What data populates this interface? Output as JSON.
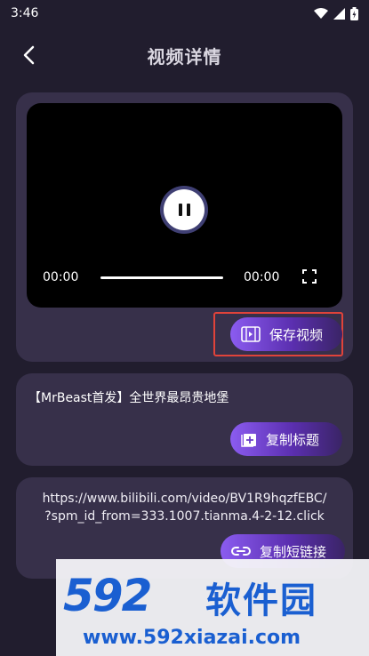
{
  "status_bar": {
    "time": "3:46"
  },
  "header": {
    "title": "视频详情"
  },
  "player": {
    "current_time": "00:00",
    "duration": "00:00",
    "progress": 0
  },
  "video_card": {
    "save_label": "保存视频"
  },
  "title_card": {
    "title": "【MrBeast首发】全世界最昂贵地堡",
    "copy_label": "复制标题"
  },
  "link_card": {
    "url_line1": "https://www.bilibili.com/video/BV1R9hqzfEBC/",
    "url_line2": "?spm_id_from=333.1007.tianma.4-2-12.click",
    "copy_label": "复制短链接"
  },
  "watermark": {
    "logo": "592",
    "name": "软件园",
    "url": "www.592xiazai.com"
  },
  "colors": {
    "background": "#211d2e",
    "card": "#37304a",
    "accent": "#8b5cf0",
    "highlight": "#e0433a",
    "watermark": "#1a5fd1"
  },
  "icons": [
    "back-icon",
    "wifi-icon",
    "signal-icon",
    "battery-icon",
    "pause-icon",
    "fullscreen-icon",
    "film-icon",
    "add-box-icon",
    "link-icon"
  ]
}
